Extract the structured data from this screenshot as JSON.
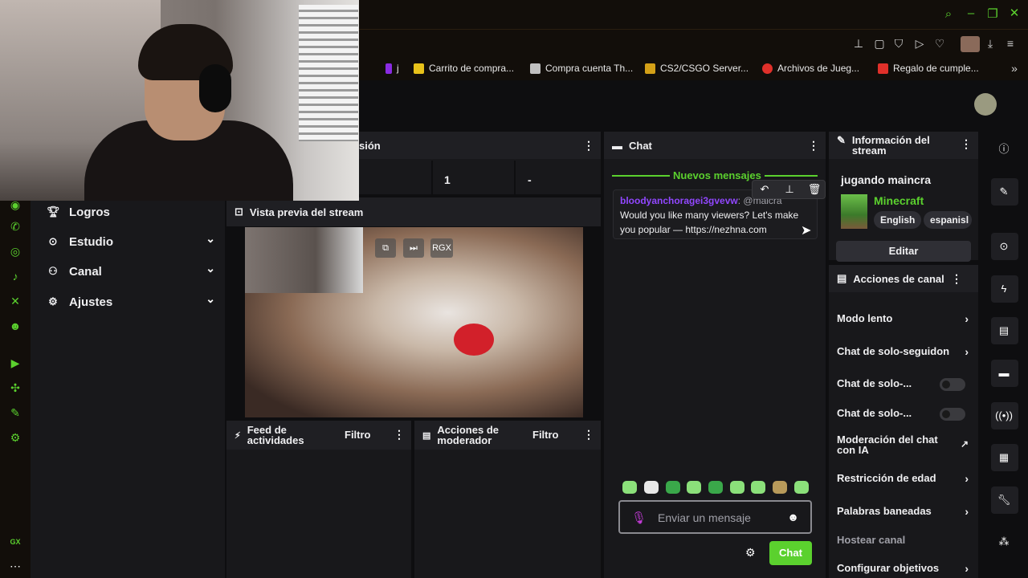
{
  "bookmarks": [
    {
      "label": "j",
      "color": "#8a2be2"
    },
    {
      "label": "Carrito de compra...",
      "color": "#e8c21a"
    },
    {
      "label": "Compra cuenta Th...",
      "color": "#c0c0c0"
    },
    {
      "label": "CS2/CSGO Server...",
      "color": "#d4a017"
    },
    {
      "label": "Archivos de Jueg...",
      "color": "#e0302a"
    },
    {
      "label": "Regalo de cumple...",
      "color": "#e0302a"
    }
  ],
  "sidenav": {
    "items": [
      {
        "label": "Logros"
      },
      {
        "label": "Estudio"
      },
      {
        "label": "Canal"
      },
      {
        "label": "Ajustes"
      }
    ]
  },
  "topstats": {
    "label_partial": "sión",
    "value": "1",
    "dash": "-"
  },
  "preview": {
    "title": "Vista previa del stream",
    "btn_rgx": "RGX"
  },
  "activity": {
    "title": "Feed de actividades",
    "filter": "Filtro"
  },
  "modactions": {
    "title": "Acciones de moderador",
    "filter": "Filtro"
  },
  "chat": {
    "title": "Chat",
    "new_messages": "Nuevos mensajes",
    "message": {
      "user": "bloodyanchoragei3gvevw",
      "mention": ": @maicra",
      "text": "Would you like many viewers? Let's make you popular — https://nezhna.com"
    },
    "placeholder": "Enviar un mensaje",
    "send": "Chat"
  },
  "info": {
    "title": "Información del stream",
    "stream_title": "jugando maincra",
    "game": "Minecraft",
    "tags": [
      "English",
      "espanisl"
    ],
    "edit": "Editar"
  },
  "actions": {
    "title": "Acciones de canal",
    "items": [
      {
        "label": "Modo lento"
      },
      {
        "label": "Chat de solo-seguidon"
      },
      {
        "label": "Chat de solo-..."
      },
      {
        "label": "Chat de solo-..."
      },
      {
        "label": "Moderación del chat con IA"
      },
      {
        "label": "Restricción de edad"
      },
      {
        "label": "Palabras baneadas"
      },
      {
        "label": "Hostear canal"
      },
      {
        "label": "Configurar objetivos"
      }
    ]
  },
  "rail": {
    "gx": "GX"
  },
  "colors": {
    "accent": "#5bd12e",
    "username": "#9147ff",
    "bg": "#0e0e10",
    "panel": "#18181b"
  }
}
